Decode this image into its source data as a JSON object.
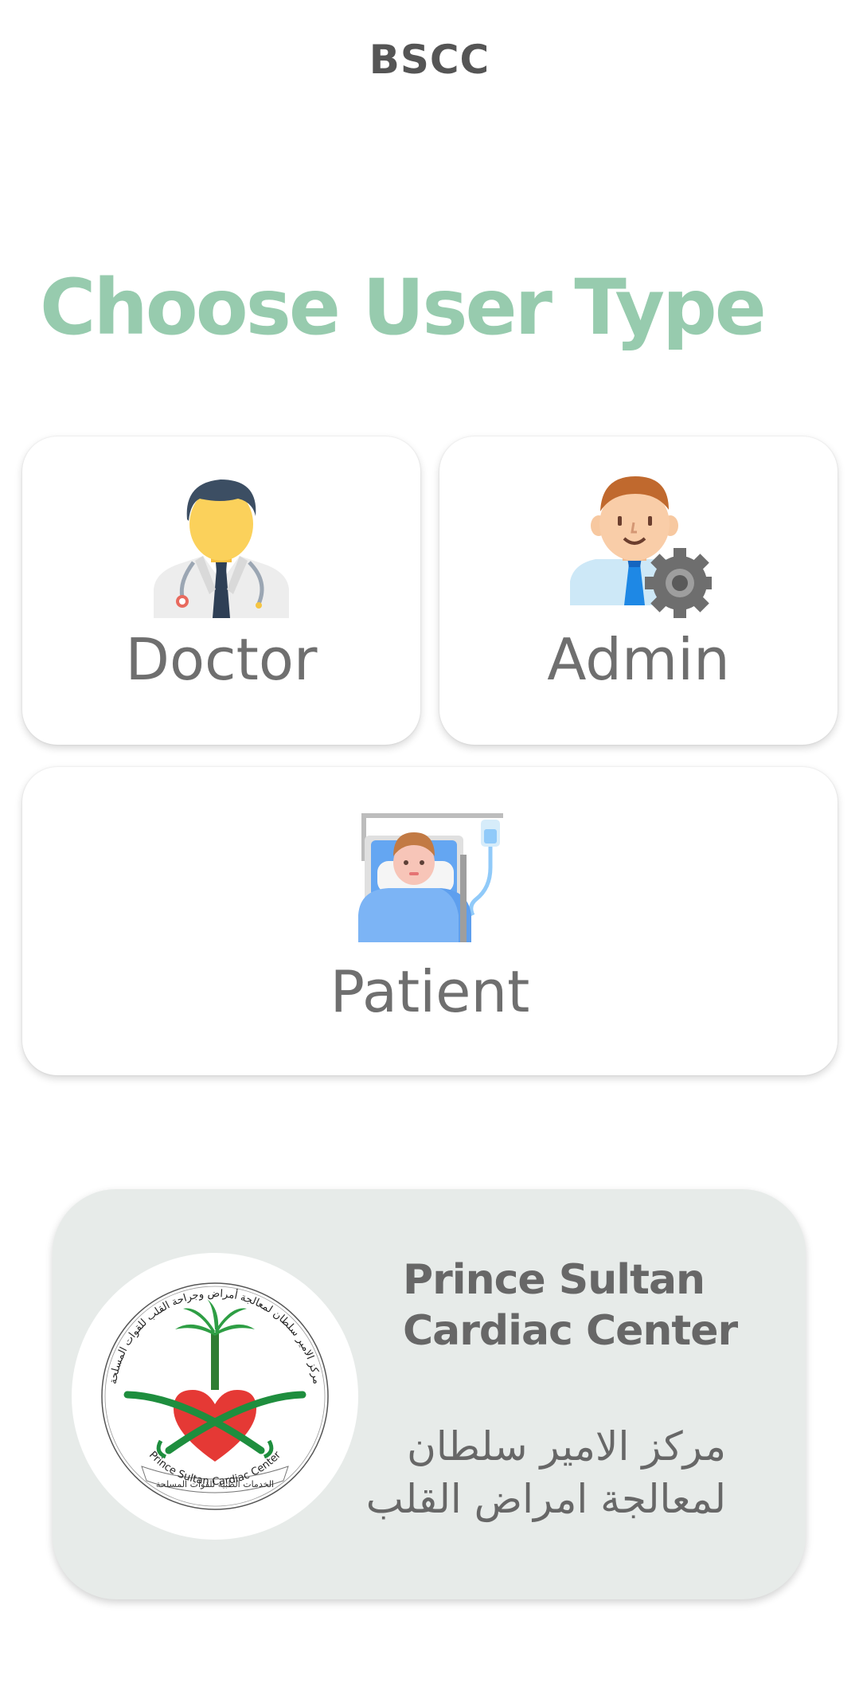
{
  "app_bar": {
    "title": "BSCC"
  },
  "heading": "Choose User Type",
  "user_types": {
    "doctor": {
      "label": "Doctor",
      "icon": "doctor-icon"
    },
    "admin": {
      "label": "Admin",
      "icon": "admin-settings-icon"
    },
    "patient": {
      "label": "Patient",
      "icon": "patient-bed-icon"
    }
  },
  "footer": {
    "name_en_line1": "Prince Sultan",
    "name_en_line2": "Cardiac Center",
    "name_ar_line1": "مركز الامير سلطان",
    "name_ar_line2": "لمعالجة امراض القلب",
    "logo": {
      "icon": "psccc-logo",
      "ring_text_top": "مركز الامير سلطان لمعالجة أمراض وجراحة القلب للقوات المسلحة",
      "ribbon_text": "الخدمات الطبية للقوات المسلحة",
      "ring_text_bottom": "Prince Sultan Cardiac Center"
    }
  },
  "colors": {
    "heading": "#97CBAE",
    "footer_bg": "#E7EBE9",
    "card_text": "#6f6f6f"
  }
}
